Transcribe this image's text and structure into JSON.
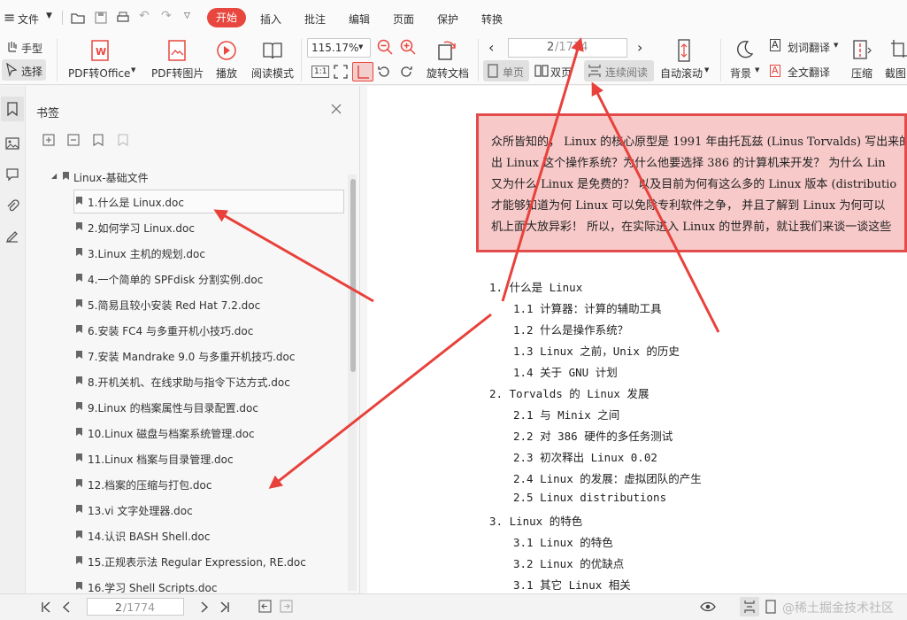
{
  "menubar": {
    "hamburger": "≡",
    "file": "文件",
    "tabs": [
      "开始",
      "插入",
      "批注",
      "编辑",
      "页面",
      "保护",
      "转换"
    ],
    "active_tab": 0
  },
  "toolbar": {
    "hand": "手型",
    "select": "选择",
    "pdf_office": "PDF转Office",
    "pdf_image": "PDF转图片",
    "play": "播放",
    "read_mode": "阅读模式",
    "zoom": "115.17%",
    "one_to_one": "1:1",
    "rotate_doc": "旋转文档",
    "page_num": "2",
    "page_total": "/1774",
    "single": "单页",
    "double": "双页",
    "continuous": "连续阅读",
    "auto_scroll": "自动滚动",
    "background": "背景",
    "word_translate": "划词翻译",
    "full_translate": "全文翻译",
    "compress": "压缩",
    "screenshot": "截图"
  },
  "sidebar": {
    "title": "书签",
    "root": "Linux-基础文件",
    "items": [
      "1.什么是 Linux.doc",
      "2.如何学习 Linux.doc",
      "3.Linux 主机的规划.doc",
      "4.一个简单的 SPFdisk 分割实例.doc",
      "5.简易且较小安装 Red Hat 7.2.doc",
      "6.安装 FC4 与多重开机小技巧.doc",
      "7.安装 Mandrake 9.0 与多重开机技巧.doc",
      "8.开机关机、在线求助与指令下达方式.doc",
      "9.Linux 的档案属性与目录配置.doc",
      "10.Linux 磁盘与档案系统管理.doc",
      "11.Linux 档案与目录管理.doc",
      "12.档案的压缩与打包.doc",
      "13.vi 文字处理器.doc",
      "14.认识 BASH Shell.doc",
      "15.正规表示法 Regular Expression, RE.doc",
      "16.学习 Shell Scripts.doc"
    ]
  },
  "document": {
    "intro": [
      "众所皆知的， Linux 的核心原型是 1991 年由托瓦兹 (Linus Torvalds) 写出来的",
      "出 Linux 这个操作系统？为什么他要选择 386 的计算机来开发？ 为什么 Lin",
      "又为什么 Linux 是免费的？ 以及目前为何有这么多的 Linux 版本 (distributio",
      "才能够知道为何 Linux 可以免除专利软件之争， 并且了解到 Linux 为何可以",
      "机上面大放异彩！ 所以，在实际进入 Linux 的世界前，就让我们来谈一谈这些"
    ],
    "toc": [
      {
        "t": "1. 什么是 Linux",
        "l": 0
      },
      {
        "t": "1.1 计算器：计算的辅助工具",
        "l": 1
      },
      {
        "t": "1.2 什么是操作系统？",
        "l": 1
      },
      {
        "t": "1.3 Linux 之前，Unix 的历史",
        "l": 1
      },
      {
        "t": "1.4 关于 GNU 计划",
        "l": 1
      },
      {
        "t": "2. Torvalds 的 Linux 发展",
        "l": 0
      },
      {
        "t": "2.1 与 Minix 之间",
        "l": 1
      },
      {
        "t": "2.2 对 386 硬件的多任务测试",
        "l": 1
      },
      {
        "t": "2.3 初次释出 Linux 0.02",
        "l": 1
      },
      {
        "t": "2.4 Linux 的发展：虚拟团队的产生",
        "l": 1
      },
      {
        "t": "2.5 Linux distributions",
        "l": 1
      },
      {
        "t": "3. Linux 的特色",
        "l": 0
      },
      {
        "t": "3.1 Linux 的特色",
        "l": 1
      },
      {
        "t": "3.2 Linux 的优缺点",
        "l": 1
      },
      {
        "t": "3.1 其它 Linux 相关",
        "l": 1
      }
    ]
  },
  "statusbar": {
    "page_num": "2",
    "page_total": "/1774"
  },
  "watermark": "@稀土掘金技术社区",
  "colors": {
    "accent": "#e8473f",
    "highlight": "#f7c9c9",
    "arrow": "#e8413b"
  }
}
